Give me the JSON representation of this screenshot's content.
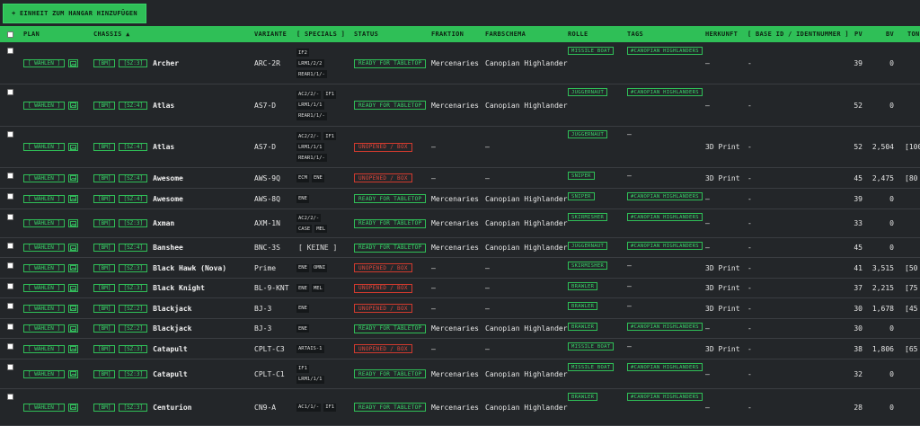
{
  "toolbar": {
    "add_label": "+ EINHEIT ZUM HANGAR HINZUFÜGEN"
  },
  "headers": {
    "plan": "PLAN",
    "chassis": "CHASSIS ▲",
    "variante": "VARIANTE",
    "specials": "[ SPECIALS ]",
    "status": "STATUS",
    "fraktion": "FRAKTION",
    "farbschema": "FARBSCHEMA",
    "rolle": "ROLLE",
    "tags": "TAGS",
    "herkunft": "HERKUNFT",
    "base_id": "[ BASE ID / IDENTNUMMER ]",
    "pv": "PV",
    "bv": "BV",
    "tonnage": "TON"
  },
  "labels": {
    "waehlen": "[ WÄHLEN ]",
    "bm": "[BM]"
  },
  "colors": {
    "accent": "#2fbf57",
    "danger": "#d13a2e",
    "bg": "#232629"
  },
  "rows": [
    {
      "sz": "[SZ:3]",
      "chassis": "Archer",
      "variante": "ARC-2R",
      "specials": [
        [
          "IF2"
        ],
        [
          "LRM1/2/2"
        ],
        [
          "REAR1/1/-"
        ]
      ],
      "status": "READY FOR TABLETOP",
      "status_type": "ready",
      "fraktion": "Mercenaries",
      "farbschema": "Canopian Highlander",
      "rolle": "MISSILE BOAT",
      "tag": "#CANOPIAN HIGHLANDERS",
      "herkunft": "—",
      "base_id": "-",
      "pv": "39",
      "bv": "0",
      "ton": ""
    },
    {
      "sz": "[SZ:4]",
      "chassis": "Atlas",
      "variante": "AS7-D",
      "specials": [
        [
          "AC2/2/-",
          "IF1"
        ],
        [
          "LRM1/1/1"
        ],
        [
          "REAR1/1/-"
        ]
      ],
      "status": "READY FOR TABLETOP",
      "status_type": "ready",
      "fraktion": "Mercenaries",
      "farbschema": "Canopian Highlander",
      "rolle": "JUGGERNAUT",
      "tag": "#CANOPIAN HIGHLANDERS",
      "herkunft": "—",
      "base_id": "-",
      "pv": "52",
      "bv": "0",
      "ton": ""
    },
    {
      "sz": "[SZ:4]",
      "chassis": "Atlas",
      "variante": "AS7-D",
      "specials": [
        [
          "AC2/2/-",
          "IF1"
        ],
        [
          "LRM1/1/1"
        ],
        [
          "REAR1/1/-"
        ]
      ],
      "status": "UNOPENED / BOX",
      "status_type": "unopened",
      "fraktion": "—",
      "farbschema": "—",
      "rolle": "JUGGERNAUT",
      "tag": "—",
      "herkunft": "3D Print",
      "base_id": "-",
      "pv": "52",
      "bv": "2,504",
      "ton": "[100"
    },
    {
      "sz": "[SZ:4]",
      "chassis": "Awesome",
      "variante": "AWS-9Q",
      "specials": [
        [
          "ECM",
          "ENE"
        ]
      ],
      "status": "UNOPENED / BOX",
      "status_type": "unopened",
      "fraktion": "—",
      "farbschema": "—",
      "rolle": "SNIPER",
      "tag": "—",
      "herkunft": "3D Print",
      "base_id": "-",
      "pv": "45",
      "bv": "2,475",
      "ton": "[80"
    },
    {
      "sz": "[SZ:4]",
      "chassis": "Awesome",
      "variante": "AWS-8Q",
      "specials": [
        [
          "ENE"
        ]
      ],
      "status": "READY FOR TABLETOP",
      "status_type": "ready",
      "fraktion": "Mercenaries",
      "farbschema": "Canopian Highlander",
      "rolle": "SNIPER",
      "tag": "#CANOPIAN HIGHLANDERS",
      "herkunft": "—",
      "base_id": "-",
      "pv": "39",
      "bv": "0",
      "ton": ""
    },
    {
      "sz": "[SZ:3]",
      "chassis": "Axman",
      "variante": "AXM-1N",
      "specials": [
        [
          "AC2/2/-"
        ],
        [
          "CASE",
          "MEL"
        ]
      ],
      "status": "READY FOR TABLETOP",
      "status_type": "ready",
      "fraktion": "Mercenaries",
      "farbschema": "Canopian Highlander",
      "rolle": "SKIRMISHER",
      "tag": "#CANOPIAN HIGHLANDERS",
      "herkunft": "—",
      "base_id": "-",
      "pv": "33",
      "bv": "0",
      "ton": ""
    },
    {
      "sz": "[SZ:4]",
      "chassis": "Banshee",
      "variante": "BNC-3S",
      "specials": [
        [
          "[ KEINE ]"
        ]
      ],
      "status": "READY FOR TABLETOP",
      "status_type": "ready",
      "fraktion": "Mercenaries",
      "farbschema": "Canopian Highlander",
      "rolle": "JUGGERNAUT",
      "tag": "#CANOPIAN HIGHLANDERS",
      "herkunft": "—",
      "base_id": "-",
      "pv": "45",
      "bv": "0",
      "ton": ""
    },
    {
      "sz": "[SZ:3]",
      "chassis": "Black Hawk (Nova)",
      "variante": "Prime",
      "specials": [
        [
          "ENE",
          "OMNI"
        ]
      ],
      "status": "UNOPENED / BOX",
      "status_type": "unopened",
      "fraktion": "—",
      "farbschema": "—",
      "rolle": "SKIRMISHER",
      "tag": "—",
      "herkunft": "3D Print",
      "base_id": "-",
      "pv": "41",
      "bv": "3,515",
      "ton": "[50"
    },
    {
      "sz": "[SZ:3]",
      "chassis": "Black Knight",
      "variante": "BL-9-KNT",
      "specials": [
        [
          "ENE",
          "MEL"
        ]
      ],
      "status": "UNOPENED / BOX",
      "status_type": "unopened",
      "fraktion": "—",
      "farbschema": "—",
      "rolle": "BRAWLER",
      "tag": "—",
      "herkunft": "3D Print",
      "base_id": "-",
      "pv": "37",
      "bv": "2,215",
      "ton": "[75"
    },
    {
      "sz": "[SZ:2]",
      "chassis": "Blackjack",
      "variante": "BJ-3",
      "specials": [
        [
          "ENE"
        ]
      ],
      "status": "UNOPENED / BOX",
      "status_type": "unopened",
      "fraktion": "—",
      "farbschema": "—",
      "rolle": "BRAWLER",
      "tag": "—",
      "herkunft": "3D Print",
      "base_id": "-",
      "pv": "30",
      "bv": "1,678",
      "ton": "[45"
    },
    {
      "sz": "[SZ:2]",
      "chassis": "Blackjack",
      "variante": "BJ-3",
      "specials": [
        [
          "ENE"
        ]
      ],
      "status": "READY FOR TABLETOP",
      "status_type": "ready",
      "fraktion": "Mercenaries",
      "farbschema": "Canopian Highlander",
      "rolle": "BRAWLER",
      "tag": "#CANOPIAN HIGHLANDERS",
      "herkunft": "—",
      "base_id": "-",
      "pv": "30",
      "bv": "0",
      "ton": ""
    },
    {
      "sz": "[SZ:3]",
      "chassis": "Catapult",
      "variante": "CPLT-C3",
      "specials": [
        [
          "ARTAIS-1"
        ]
      ],
      "status": "UNOPENED / BOX",
      "status_type": "unopened",
      "fraktion": "—",
      "farbschema": "—",
      "rolle": "MISSILE BOAT",
      "tag": "—",
      "herkunft": "3D Print",
      "base_id": "-",
      "pv": "38",
      "bv": "1,806",
      "ton": "[65"
    },
    {
      "sz": "[SZ:3]",
      "chassis": "Catapult",
      "variante": "CPLT-C1",
      "specials": [
        [
          "IF1"
        ],
        [
          "LRM1/1/1"
        ]
      ],
      "status": "READY FOR TABLETOP",
      "status_type": "ready",
      "fraktion": "Mercenaries",
      "farbschema": "Canopian Highlander",
      "rolle": "MISSILE BOAT",
      "tag": "#CANOPIAN HIGHLANDERS",
      "herkunft": "—",
      "base_id": "-",
      "pv": "32",
      "bv": "0",
      "ton": ""
    },
    {
      "sz": "[SZ:3]",
      "chassis": "Centurion",
      "variante": "CN9-A",
      "specials": [
        [
          "AC1/1/-",
          "IF1"
        ]
      ],
      "status": "READY FOR TABLETOP",
      "status_type": "ready",
      "fraktion": "Mercenaries",
      "farbschema": "Canopian Highlander",
      "rolle": "BRAWLER",
      "tag": "#CANOPIAN HIGHLANDERS",
      "herkunft": "—",
      "base_id": "-",
      "pv": "28",
      "bv": "0",
      "ton": ""
    }
  ]
}
